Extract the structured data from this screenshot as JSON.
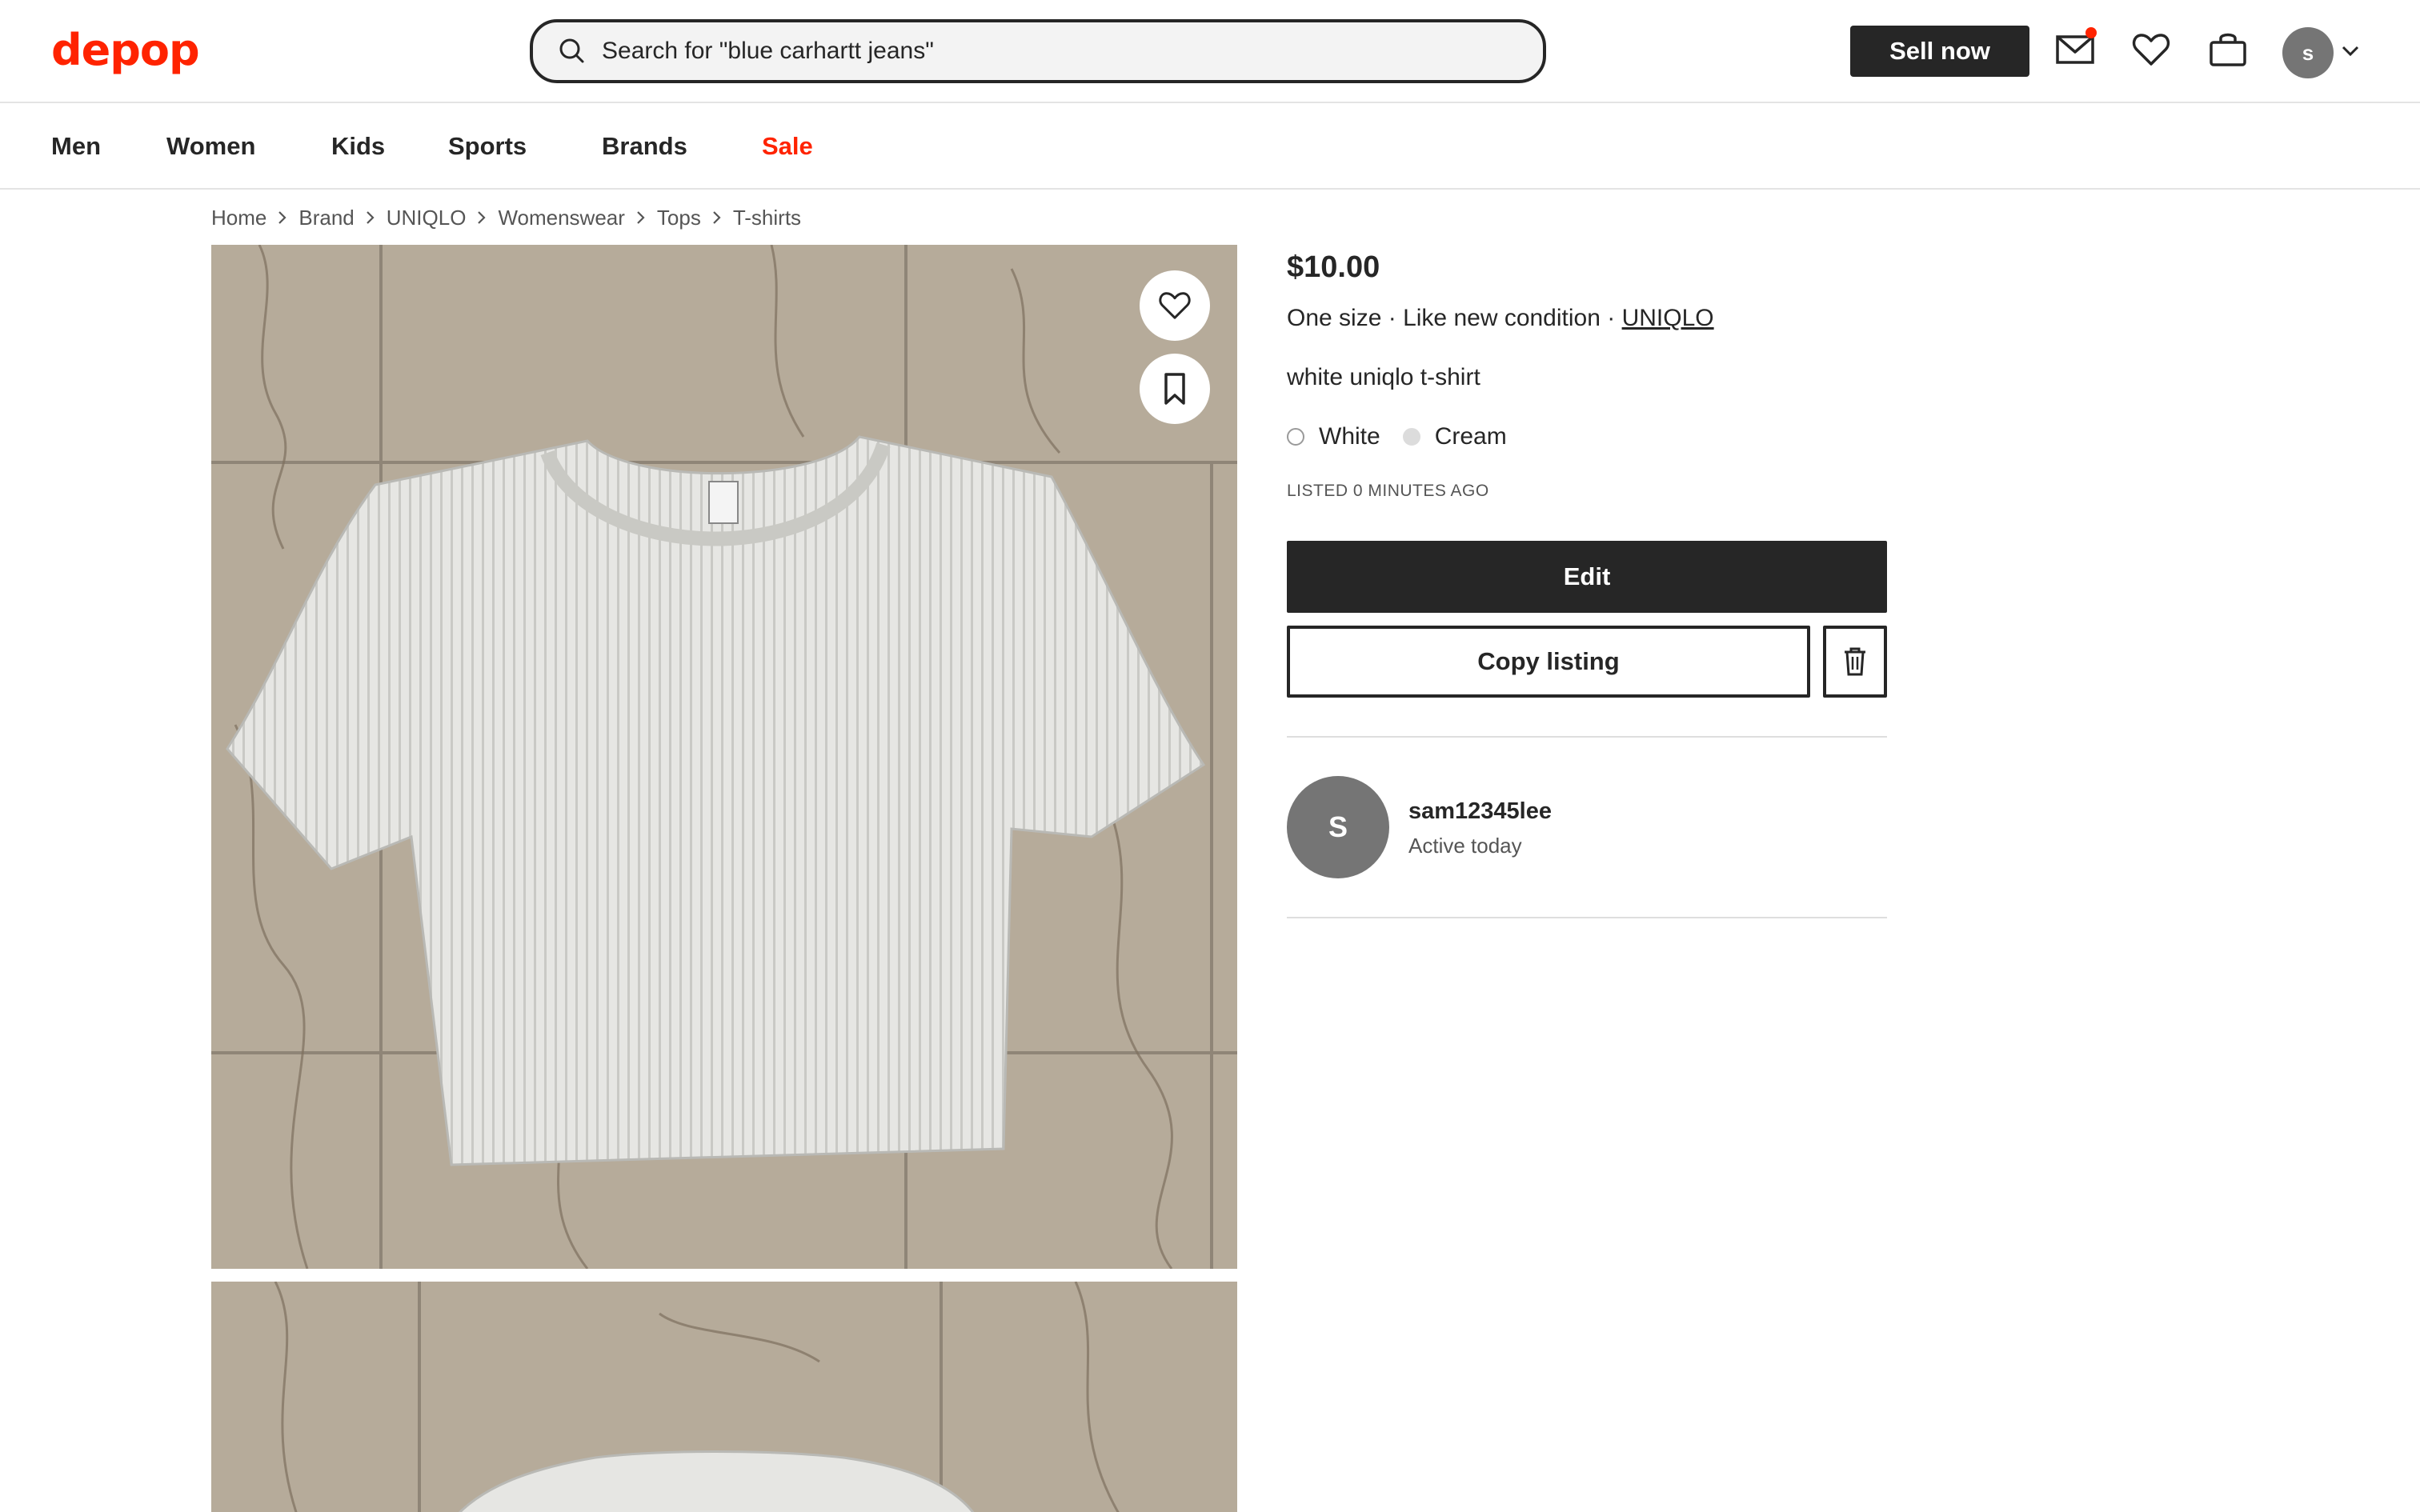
{
  "brand": {
    "logo_text": "depop",
    "color": "#ff2300"
  },
  "header": {
    "search_placeholder": "Search for \"blue carhartt jeans\"",
    "sell_label": "Sell now",
    "icons": [
      "search-icon",
      "mail-icon",
      "heart-icon",
      "bag-icon",
      "chevron-down-icon"
    ],
    "avatar_initial": "s"
  },
  "nav": {
    "items": [
      {
        "label": "Men"
      },
      {
        "label": "Women"
      },
      {
        "label": "Kids"
      },
      {
        "label": "Sports"
      },
      {
        "label": "Brands"
      },
      {
        "label": "Sale",
        "color": "#ff2300"
      }
    ]
  },
  "breadcrumb": [
    "Home",
    "Brand",
    "UNIQLO",
    "Womenswear",
    "Tops",
    "T-shirts"
  ],
  "listing": {
    "price": "$10.00",
    "size": "One size",
    "condition": "Like new condition",
    "brand": "UNIQLO",
    "separator": "·",
    "description": "white uniqlo t-shirt",
    "colors": [
      {
        "label": "White",
        "swatch": "#ffffff"
      },
      {
        "label": "Cream",
        "swatch": "#dcdcdc"
      }
    ],
    "listed": "LISTED 0 MINUTES AGO",
    "edit_label": "Edit",
    "copy_label": "Copy listing"
  },
  "seller": {
    "initial": "S",
    "username": "sam12345lee",
    "status": "Active today"
  }
}
